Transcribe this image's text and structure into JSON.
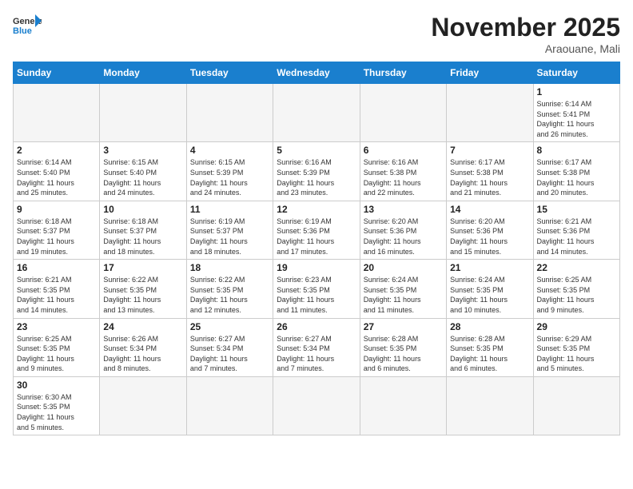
{
  "header": {
    "logo_general": "General",
    "logo_blue": "Blue",
    "month_title": "November 2025",
    "subtitle": "Araouane, Mali"
  },
  "weekdays": [
    "Sunday",
    "Monday",
    "Tuesday",
    "Wednesday",
    "Thursday",
    "Friday",
    "Saturday"
  ],
  "weeks": [
    [
      {
        "day": "",
        "info": ""
      },
      {
        "day": "",
        "info": ""
      },
      {
        "day": "",
        "info": ""
      },
      {
        "day": "",
        "info": ""
      },
      {
        "day": "",
        "info": ""
      },
      {
        "day": "",
        "info": ""
      },
      {
        "day": "1",
        "info": "Sunrise: 6:14 AM\nSunset: 5:41 PM\nDaylight: 11 hours\nand 26 minutes."
      }
    ],
    [
      {
        "day": "2",
        "info": "Sunrise: 6:14 AM\nSunset: 5:40 PM\nDaylight: 11 hours\nand 25 minutes."
      },
      {
        "day": "3",
        "info": "Sunrise: 6:15 AM\nSunset: 5:40 PM\nDaylight: 11 hours\nand 24 minutes."
      },
      {
        "day": "4",
        "info": "Sunrise: 6:15 AM\nSunset: 5:39 PM\nDaylight: 11 hours\nand 24 minutes."
      },
      {
        "day": "5",
        "info": "Sunrise: 6:16 AM\nSunset: 5:39 PM\nDaylight: 11 hours\nand 23 minutes."
      },
      {
        "day": "6",
        "info": "Sunrise: 6:16 AM\nSunset: 5:38 PM\nDaylight: 11 hours\nand 22 minutes."
      },
      {
        "day": "7",
        "info": "Sunrise: 6:17 AM\nSunset: 5:38 PM\nDaylight: 11 hours\nand 21 minutes."
      },
      {
        "day": "8",
        "info": "Sunrise: 6:17 AM\nSunset: 5:38 PM\nDaylight: 11 hours\nand 20 minutes."
      }
    ],
    [
      {
        "day": "9",
        "info": "Sunrise: 6:18 AM\nSunset: 5:37 PM\nDaylight: 11 hours\nand 19 minutes."
      },
      {
        "day": "10",
        "info": "Sunrise: 6:18 AM\nSunset: 5:37 PM\nDaylight: 11 hours\nand 18 minutes."
      },
      {
        "day": "11",
        "info": "Sunrise: 6:19 AM\nSunset: 5:37 PM\nDaylight: 11 hours\nand 18 minutes."
      },
      {
        "day": "12",
        "info": "Sunrise: 6:19 AM\nSunset: 5:36 PM\nDaylight: 11 hours\nand 17 minutes."
      },
      {
        "day": "13",
        "info": "Sunrise: 6:20 AM\nSunset: 5:36 PM\nDaylight: 11 hours\nand 16 minutes."
      },
      {
        "day": "14",
        "info": "Sunrise: 6:20 AM\nSunset: 5:36 PM\nDaylight: 11 hours\nand 15 minutes."
      },
      {
        "day": "15",
        "info": "Sunrise: 6:21 AM\nSunset: 5:36 PM\nDaylight: 11 hours\nand 14 minutes."
      }
    ],
    [
      {
        "day": "16",
        "info": "Sunrise: 6:21 AM\nSunset: 5:35 PM\nDaylight: 11 hours\nand 14 minutes."
      },
      {
        "day": "17",
        "info": "Sunrise: 6:22 AM\nSunset: 5:35 PM\nDaylight: 11 hours\nand 13 minutes."
      },
      {
        "day": "18",
        "info": "Sunrise: 6:22 AM\nSunset: 5:35 PM\nDaylight: 11 hours\nand 12 minutes."
      },
      {
        "day": "19",
        "info": "Sunrise: 6:23 AM\nSunset: 5:35 PM\nDaylight: 11 hours\nand 11 minutes."
      },
      {
        "day": "20",
        "info": "Sunrise: 6:24 AM\nSunset: 5:35 PM\nDaylight: 11 hours\nand 11 minutes."
      },
      {
        "day": "21",
        "info": "Sunrise: 6:24 AM\nSunset: 5:35 PM\nDaylight: 11 hours\nand 10 minutes."
      },
      {
        "day": "22",
        "info": "Sunrise: 6:25 AM\nSunset: 5:35 PM\nDaylight: 11 hours\nand 9 minutes."
      }
    ],
    [
      {
        "day": "23",
        "info": "Sunrise: 6:25 AM\nSunset: 5:35 PM\nDaylight: 11 hours\nand 9 minutes."
      },
      {
        "day": "24",
        "info": "Sunrise: 6:26 AM\nSunset: 5:34 PM\nDaylight: 11 hours\nand 8 minutes."
      },
      {
        "day": "25",
        "info": "Sunrise: 6:27 AM\nSunset: 5:34 PM\nDaylight: 11 hours\nand 7 minutes."
      },
      {
        "day": "26",
        "info": "Sunrise: 6:27 AM\nSunset: 5:34 PM\nDaylight: 11 hours\nand 7 minutes."
      },
      {
        "day": "27",
        "info": "Sunrise: 6:28 AM\nSunset: 5:35 PM\nDaylight: 11 hours\nand 6 minutes."
      },
      {
        "day": "28",
        "info": "Sunrise: 6:28 AM\nSunset: 5:35 PM\nDaylight: 11 hours\nand 6 minutes."
      },
      {
        "day": "29",
        "info": "Sunrise: 6:29 AM\nSunset: 5:35 PM\nDaylight: 11 hours\nand 5 minutes."
      }
    ],
    [
      {
        "day": "30",
        "info": "Sunrise: 6:30 AM\nSunset: 5:35 PM\nDaylight: 11 hours\nand 5 minutes."
      },
      {
        "day": "",
        "info": ""
      },
      {
        "day": "",
        "info": ""
      },
      {
        "day": "",
        "info": ""
      },
      {
        "day": "",
        "info": ""
      },
      {
        "day": "",
        "info": ""
      },
      {
        "day": "",
        "info": ""
      }
    ]
  ]
}
